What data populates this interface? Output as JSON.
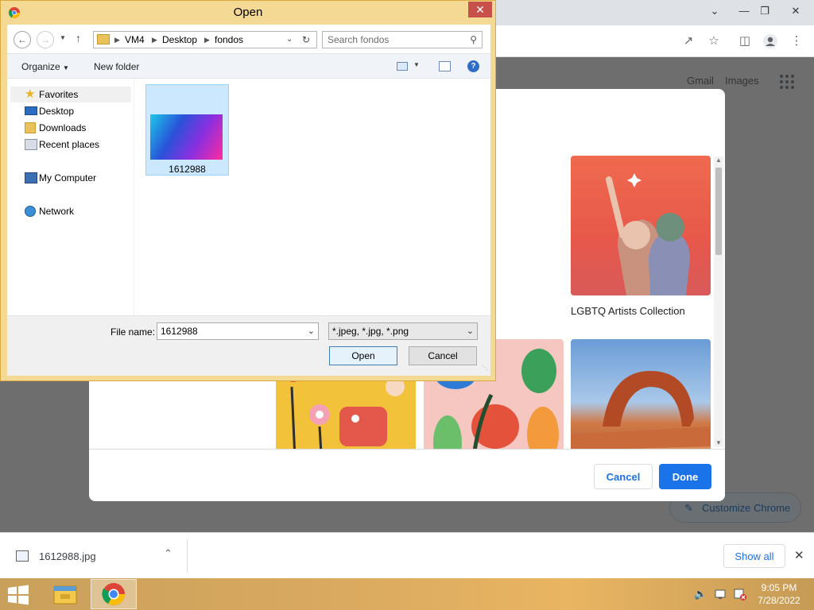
{
  "browser": {
    "ntp_links": [
      "Gmail",
      "Images"
    ],
    "customize_chrome_label": "Customize Chrome"
  },
  "customize_dialog": {
    "tiles": [
      {
        "label": ""
      },
      {
        "label": "LGBTQ Artists Collection"
      },
      {
        "label": ""
      },
      {
        "label": ""
      },
      {
        "label": ""
      }
    ],
    "cancel_label": "Cancel",
    "done_label": "Done",
    "accent_color": "#1a73e8"
  },
  "open_dialog": {
    "title": "Open",
    "path": [
      "VM4",
      "Desktop",
      "fondos"
    ],
    "search_placeholder": "Search fondos",
    "organize_label": "Organize",
    "new_folder_label": "New folder",
    "nav_tree": [
      {
        "label": "Favorites",
        "icon": "star-icon"
      },
      {
        "label": "Desktop",
        "icon": "desktop-icon"
      },
      {
        "label": "Downloads",
        "icon": "downloads-icon"
      },
      {
        "label": "Recent places",
        "icon": "recent-places-icon"
      },
      {
        "label": "My Computer",
        "icon": "computer-icon"
      },
      {
        "label": "Network",
        "icon": "network-icon"
      }
    ],
    "files": [
      {
        "name": "1612988"
      }
    ],
    "file_name_label": "File name:",
    "file_name_value": "1612988",
    "file_type_value": "*.jpeg, *.jpg, *.png",
    "open_label": "Open",
    "cancel_label": "Cancel"
  },
  "download_bar": {
    "file_name": "1612988.jpg",
    "show_all_label": "Show all"
  },
  "taskbar": {
    "time": "9:05 PM",
    "date": "7/28/2022"
  }
}
